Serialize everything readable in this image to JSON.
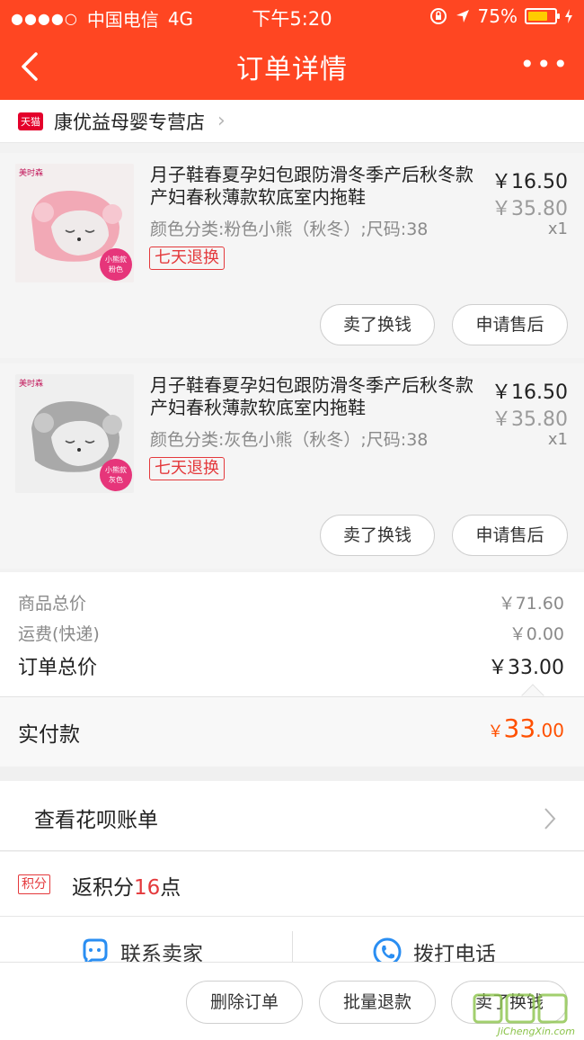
{
  "status_bar": {
    "signal_dots": "●●●●○",
    "carrier": "中国电信",
    "network": "4G",
    "time": "下午5:20",
    "battery": "75%",
    "battery_level": 0.75,
    "battery_color": "#ffcc00"
  },
  "nav": {
    "title": "订单详情",
    "more": "•••",
    "back_icon": "chevron-left-icon"
  },
  "shop": {
    "badge": "天猫",
    "name": "康优益母婴专营店",
    "chevron": "›"
  },
  "items": [
    {
      "title": "月子鞋春夏孕妇包跟防滑冬季产后秋冬款产妇春秋薄款软底室内拖鞋",
      "spec": "颜色分类:粉色小熊（秋冬）;尺码:38",
      "tag": "七天退换",
      "price": "￥16.50",
      "original_price": "￥35.80",
      "qty": "x1",
      "thumb_brand": "美时森",
      "thumb_badge_line1": "小熊款",
      "thumb_badge_line2": "粉色",
      "thumb_color": "#f2a9b6",
      "btn_sell": "卖了换钱",
      "btn_after": "申请售后"
    },
    {
      "title": "月子鞋春夏孕妇包跟防滑冬季产后秋冬款产妇春秋薄款软底室内拖鞋",
      "spec": "颜色分类:灰色小熊（秋冬）;尺码:38",
      "tag": "七天退换",
      "price": "￥16.50",
      "original_price": "￥35.80",
      "qty": "x1",
      "thumb_brand": "美时森",
      "thumb_badge_line1": "小熊款",
      "thumb_badge_line2": "灰色",
      "thumb_color": "#b4b4b4",
      "btn_sell": "卖了换钱",
      "btn_after": "申请售后"
    }
  ],
  "summary": {
    "goods_total_label": "商品总价",
    "goods_total": "￥71.60",
    "shipping_label": "运费(快递)",
    "shipping": "￥0.00",
    "order_total_label": "订单总价",
    "order_total": "￥33.00"
  },
  "paid": {
    "label": "实付款",
    "currency": "￥",
    "integer": "33",
    "decimal": ".00"
  },
  "huabei": {
    "label": "查看花呗账单"
  },
  "points": {
    "badge": "积分",
    "prefix": "返积分",
    "num": "16",
    "suffix": "点"
  },
  "contact": {
    "seller": "联系卖家",
    "phone": "拨打电话"
  },
  "bottom_bar": {
    "delete": "删除订单",
    "refund": "批量退款",
    "sell": "卖了换钱"
  },
  "watermark": {
    "text": "JiChengXin.com"
  },
  "colors": {
    "brand": "#ff4622",
    "price_accent": "#ff5000",
    "tag_red": "#e4393c"
  }
}
